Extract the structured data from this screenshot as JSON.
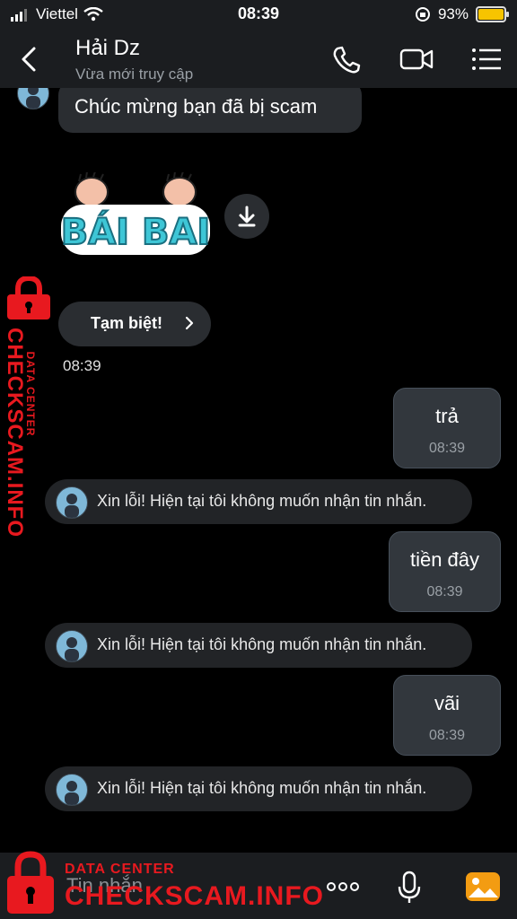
{
  "status": {
    "carrier": "Viettel",
    "time": "08:39",
    "battery": "93%",
    "battery_level": 0.93
  },
  "header": {
    "title": "Hải Dz",
    "subtitle": "Vừa mới truy cập",
    "icons": [
      "back-icon",
      "phone-icon",
      "video-call-icon",
      "menu-list-icon"
    ]
  },
  "messages": {
    "received_text": "Chúc mừng bạn đã bị scam",
    "sticker_text": "BÁI BAI",
    "sticker_link": "Tạm biệt!",
    "received_time": "08:39",
    "sent": [
      {
        "text": "trả",
        "time": "08:39"
      },
      {
        "text": "tiền đây",
        "time": "08:39"
      },
      {
        "text": "vãi",
        "time": "08:39"
      }
    ],
    "auto_reply": "Xin lỗi! Hiện tại tôi không muốn nhận tin nhắn."
  },
  "input": {
    "placeholder": "Tin nhắn"
  },
  "watermark": {
    "small": "DATA CENTER",
    "big": "CHECKSCAM.INFO"
  },
  "colors": {
    "background": "#000000",
    "bar": "#1b1d20",
    "bubble": "#2a2d31",
    "watermark": "#e8191f",
    "battery": "#f7c400"
  }
}
